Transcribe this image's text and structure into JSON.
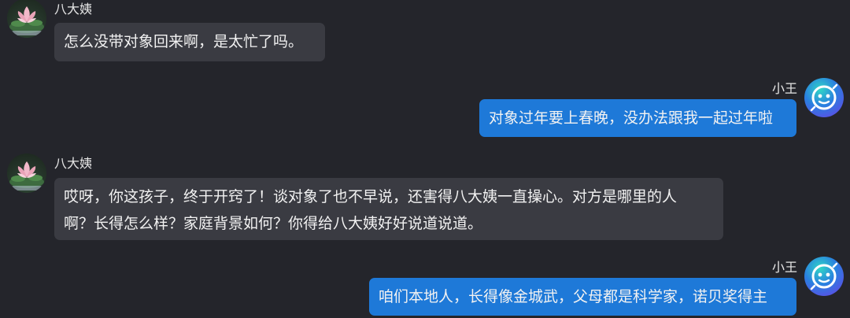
{
  "messages": [
    {
      "sender": "八大姨",
      "side": "left",
      "lines": [
        "怎么没带对象回来啊，是太忙了吗。"
      ]
    },
    {
      "sender": "小王",
      "side": "right",
      "lines": [
        "对象过年要上春晚，没办法跟我一起过年啦"
      ]
    },
    {
      "sender": "八大姨",
      "side": "left",
      "lines": [
        "哎呀，你这孩子，终于开窍了！谈对象了也不早说，还害得八大姨一直操心。对方是哪里的人",
        "啊？长得怎么样？家庭背景如何？你得给八大姨好好说道说道。"
      ]
    },
    {
      "sender": "小王",
      "side": "right",
      "lines": [
        "咱们本地人，长得像金城武，父母都是科学家，诺贝奖得主"
      ]
    }
  ],
  "avatars": {
    "aunt": {
      "icon": "lotus-avatar-icon",
      "partial_text": "■■■■"
    },
    "wang": {
      "icon": "robot-avatar-icon"
    }
  },
  "colors": {
    "background": "#24252b",
    "left_bubble": "#3a3b42",
    "right_bubble": "#1e79d8",
    "text": "#f2f2f2"
  }
}
